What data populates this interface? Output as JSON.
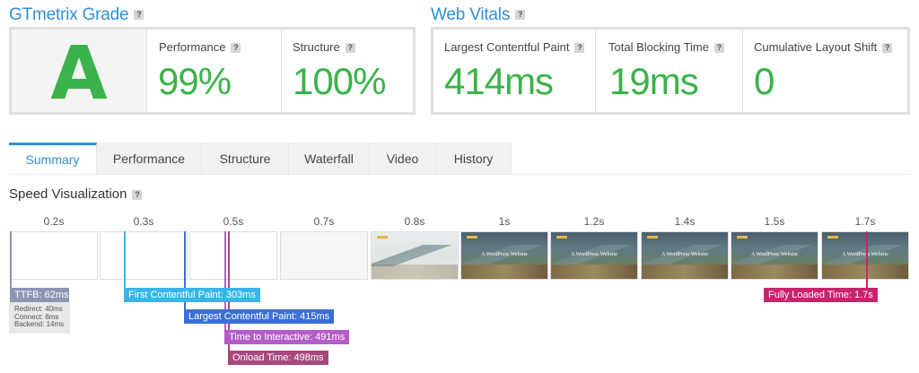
{
  "grade": {
    "title": "GTmetrix Grade",
    "help": "?",
    "letter": "A",
    "performance_label": "Performance",
    "performance_value": "99%",
    "structure_label": "Structure",
    "structure_value": "100%"
  },
  "vitals": {
    "title": "Web Vitals",
    "help": "?",
    "lcp_label": "Largest Contentful Paint",
    "lcp_value": "414ms",
    "tbt_label": "Total Blocking Time",
    "tbt_value": "19ms",
    "cls_label": "Cumulative Layout Shift",
    "cls_value": "0"
  },
  "tabs": [
    "Summary",
    "Performance",
    "Structure",
    "Waterfall",
    "Video",
    "History"
  ],
  "active_tab": "Summary",
  "speed": {
    "title": "Speed Visualization",
    "help": "?",
    "times": [
      "0.2s",
      "0.3s",
      "0.5s",
      "0.7s",
      "0.8s",
      "1s",
      "1.2s",
      "1.4s",
      "1.5s",
      "1.7s"
    ],
    "frame_headline": "A WordPress Website",
    "markers": {
      "ttfb": "TTFB: 62ms",
      "fcp": "First Contentful Paint: 303ms",
      "lcp": "Largest Contentful Paint: 415ms",
      "tti": "Time to Interactive: 491ms",
      "onload": "Onload Time: 498ms",
      "fully_loaded": "Fully Loaded Time: 1.7s"
    },
    "ttfb_details": {
      "redirect": "Redirect: 40ms",
      "connect": "Connect: 8ms",
      "backend": "Backend: 14ms"
    }
  },
  "colors": {
    "accent": "#2f8fd6",
    "grade_green": "#3bb34a",
    "ttfb": "#8e95b2",
    "fcp": "#37b5e8",
    "lcp": "#3a6fd8",
    "tti": "#b45cc7",
    "onload": "#a8487e",
    "fully_loaded": "#c8246d"
  }
}
